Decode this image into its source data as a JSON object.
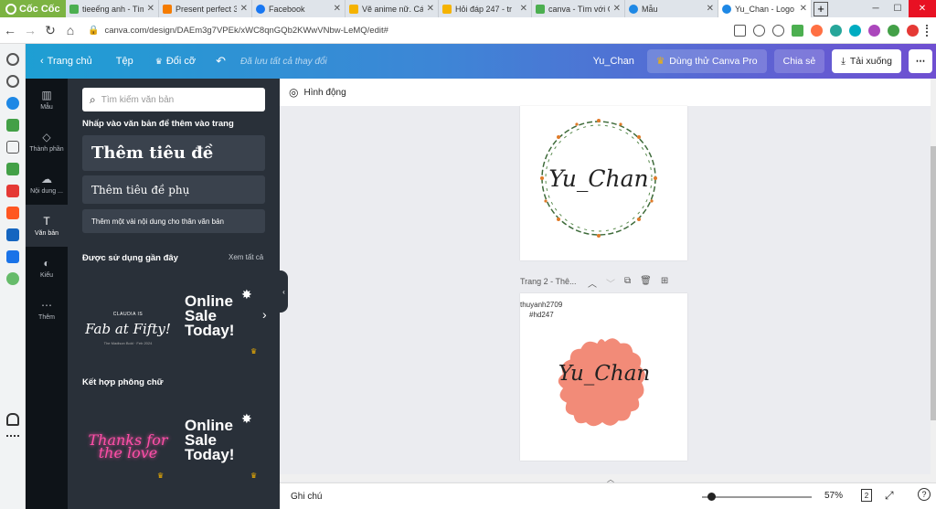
{
  "browser": {
    "brand": "Cốc Cốc",
    "tabs": [
      {
        "title": "tieeếng anh - Tìm",
        "color": "#4caf50"
      },
      {
        "title": "Present perfect 3",
        "color": "#f57c00"
      },
      {
        "title": "Facebook",
        "color": "#1877f2"
      },
      {
        "title": "Vẽ anime nữ. Cái",
        "color": "#f5b301"
      },
      {
        "title": "Hỏi đáp 247 - tr",
        "color": "#f5b301"
      },
      {
        "title": "canva - Tìm với C",
        "color": "#4caf50"
      },
      {
        "title": "Mẫu",
        "color": "#1e88e5"
      },
      {
        "title": "Yu_Chan - Logo",
        "color": "#1e88e5"
      }
    ],
    "url": "canva.com/design/DAEm3g7VPEk/xWC8qnGQb2KWwVNbw-LeMQ/edit#"
  },
  "topbar": {
    "home": "Trang chủ",
    "file": "Tệp",
    "resize": "Đổi cỡ",
    "saved": "Đã lưu tất cả thay đổi",
    "design_name": "Yu_Chan",
    "try_pro": "Dùng thử Canva Pro",
    "share": "Chia sẻ",
    "download": "Tải xuống"
  },
  "rail": [
    {
      "label": "Mẫu",
      "icon": "□"
    },
    {
      "label": "Thành phần",
      "icon": "◇"
    },
    {
      "label": "Nội dung ...",
      "icon": "☁"
    },
    {
      "label": "Văn bản",
      "icon": "T"
    },
    {
      "label": "Kiểu",
      "icon": "◐"
    },
    {
      "label": "Thêm",
      "icon": "⋯"
    }
  ],
  "panel": {
    "search_placeholder": "Tìm kiếm văn bản",
    "hint": "Nhấp vào văn bản để thêm vào trang",
    "add_heading": "Thêm tiêu đề",
    "add_subheading": "Thêm tiêu đề phụ",
    "add_body": "Thêm một vài nội dung cho thân văn bản",
    "recent_title": "Được sử dụng gần đây",
    "see_all": "Xem tất cả",
    "combo_title": "Kết hợp phông chữ",
    "thumb_fab": {
      "line1": "CLAUDIA IS",
      "line2": "Fab at Fifty!",
      "line3": "The Madison Bold · Feb 2024"
    },
    "thumb_sale": "Online Sale Today!",
    "thumb_thanks": "Thanks for the love"
  },
  "canvas": {
    "animate": "Hình động",
    "page1_text": "Yu_Chan",
    "page2_label": "Trang 2 - Thê...",
    "page2_watermark1": "thuyanh2709",
    "page2_watermark2": "#hd247",
    "page2_text": "Yu_Chan",
    "badge_color": "#f28b78"
  },
  "bottom": {
    "notes": "Ghi chú",
    "zoom": "57%",
    "page_count": "2"
  }
}
